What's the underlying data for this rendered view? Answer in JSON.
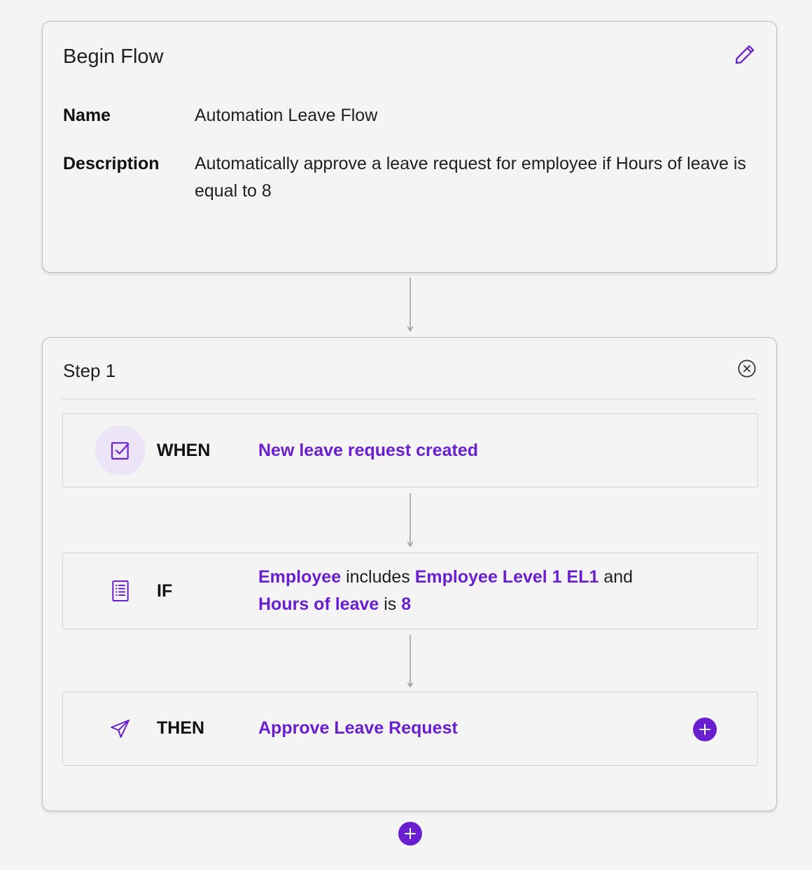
{
  "begin_flow": {
    "title": "Begin Flow",
    "name_label": "Name",
    "name_value": "Automation Leave Flow",
    "description_label": "Description",
    "description_value": "Automatically approve a leave request for employee if Hours of leave is equal to 8",
    "edit_icon": "pencil-icon"
  },
  "step": {
    "title": "Step 1",
    "close_icon": "close-circle-icon",
    "when": {
      "keyword": "WHEN",
      "icon": "checkbox-icon",
      "value": "New leave request created"
    },
    "if": {
      "keyword": "IF",
      "icon": "document-list-icon",
      "field1": "Employee",
      "op1": "includes",
      "value1": "Employee Level 1 EL1",
      "conj": "and",
      "field2": "Hours of leave",
      "op2": "is",
      "value2": "8"
    },
    "then": {
      "keyword": "THEN",
      "icon": "send-icon",
      "value": "Approve Leave Request",
      "add_icon": "plus-circle-icon"
    }
  },
  "add_step_icon": "plus-circle-icon",
  "colors": {
    "accent": "#6a1fcf",
    "background": "#f4f4f4",
    "border": "#bdbdbd",
    "when_icon_bg": "#ece4f7"
  }
}
